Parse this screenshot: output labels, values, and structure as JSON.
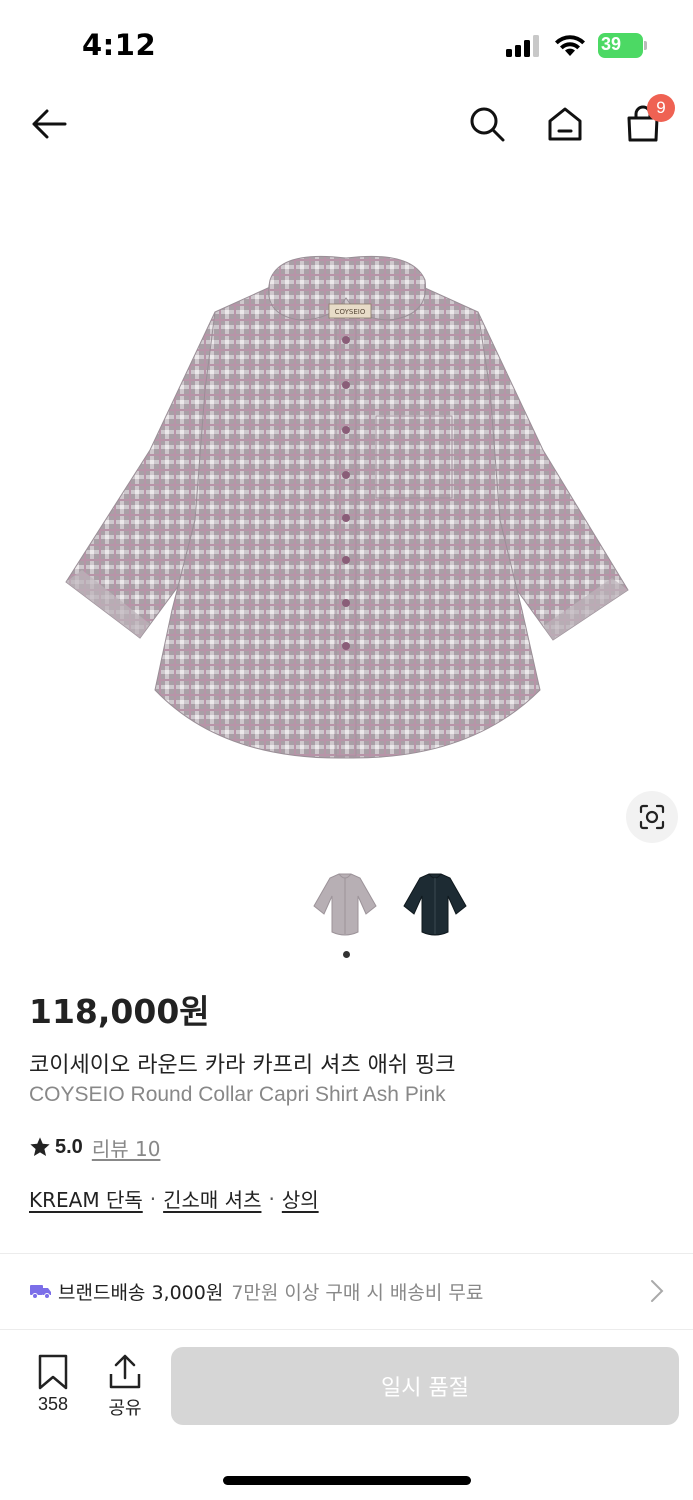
{
  "status_bar": {
    "time": "4:12",
    "battery": "39"
  },
  "nav": {
    "cart_count": "9"
  },
  "product": {
    "price": "118,000원",
    "title_ko": "코이세이오 라운드 카라 카프리 셔츠 애쉬 핑크",
    "title_en": "COYSEIO Round Collar Capri Shirt Ash Pink",
    "label_tag": "COYSEIO",
    "rating": "5.0",
    "review_label": "리뷰 10",
    "tags": [
      "KREAM 단독",
      "긴소매 셔츠",
      "상의"
    ],
    "tag_separator": "·"
  },
  "gallery": {
    "thumbnails": [
      "ash-pink-shirt",
      "navy-shirt"
    ],
    "current_index": 1,
    "total": 1
  },
  "shipping": {
    "label": "브랜드배송 3,000원",
    "sub": "7만원 이상 구매 시 배송비 무료"
  },
  "bottom": {
    "bookmark_count": "358",
    "share_label": "공유",
    "buy_label": "일시 품절"
  },
  "colors": {
    "accent_badge": "#ef6253",
    "battery_green": "#4cd964",
    "soldout_bg": "#d6d6d6",
    "truck": "#7b6ee8"
  }
}
